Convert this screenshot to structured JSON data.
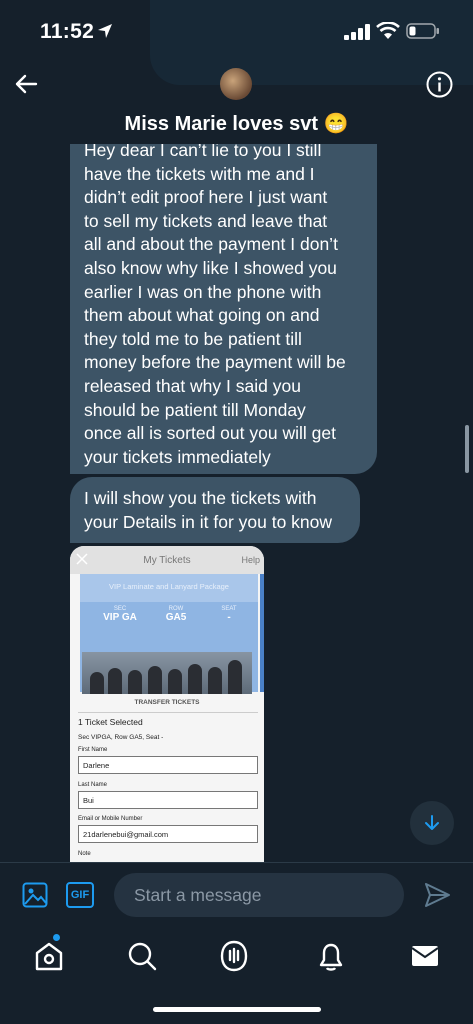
{
  "status_bar": {
    "time": "11:52"
  },
  "header": {
    "title": "Miss Marie loves svt 😁"
  },
  "messages": [
    {
      "lines": [
        "Hey dear I can’t lie to you I still",
        "have the tickets with me and I",
        "didn’t edit proof here I just want",
        "to sell my tickets and leave that",
        "all and about the payment I don’t",
        "also know why like I showed you",
        "earlier I was on the phone with",
        "them about what going on and",
        "they told me to be patient till",
        "money before the payment will be",
        "released that why I said you",
        "should be patient till Monday",
        "once all is sorted out you will get",
        "your tickets immediately"
      ]
    },
    {
      "lines": [
        "I will show you the tickets with",
        "your Details in it for you to know"
      ]
    }
  ],
  "attachment": {
    "title": "My Tickets",
    "help": "Help",
    "package": "VIP Laminate and Lanyard Package",
    "sec_label": "SEC",
    "sec_value": "VIP GA",
    "row_label": "ROW",
    "row_value": "GA5",
    "seat_label": "SEAT",
    "seat_value": "-",
    "transfer": "TRANSFER TICKETS",
    "selected": "1 Ticket Selected",
    "summary": "Sec VIPGA, Row GA5, Seat -",
    "first_name_label": "First Name",
    "first_name_value": "Darlene",
    "last_name_label": "Last Name",
    "last_name_value": "Bui",
    "email_label": "Email or Mobile Number",
    "email_value": "21darlenebui@gmail.com",
    "note_label": "Note"
  },
  "composer": {
    "placeholder": "Start a message",
    "gif_label": "GIF"
  },
  "colors": {
    "background": "#15202b",
    "bubble": "#3d5466",
    "accent": "#1d9bf0"
  },
  "icons": [
    "back-arrow-icon",
    "info-icon",
    "media-icon",
    "gif-icon",
    "send-icon",
    "chevron-down-icon",
    "home-icon",
    "search-icon",
    "spaces-icon",
    "bell-icon",
    "mail-icon"
  ]
}
